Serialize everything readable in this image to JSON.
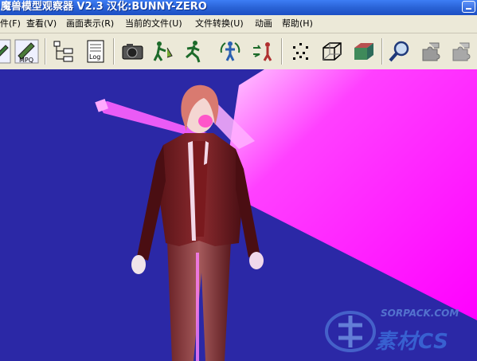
{
  "window": {
    "title": "魔兽模型观察器 V2.3 汉化:BUNNY-ZERO"
  },
  "menu": [
    {
      "label": "件(F)"
    },
    {
      "label": "查看(V)"
    },
    {
      "label": "画面表示(R)"
    },
    {
      "label": "当前的文件(U)"
    },
    {
      "label": "文件转换(U)"
    },
    {
      "label": "动画"
    },
    {
      "label": "帮助(H)"
    }
  ],
  "toolbar": {
    "icons": [
      "pen-icon",
      "mpq-icon",
      "tree-icon",
      "log-icon",
      "camera-icon",
      "model-pose-icon",
      "run-figure-icon",
      "rotate-figure-icon",
      "swap-figure-icon",
      "particles-icon",
      "wireframe-box-icon",
      "solid-box-icon",
      "magnify-icon",
      "puzzle-icon",
      "puzzle-disabled-icon"
    ],
    "mpq_label": "MPQ",
    "log_label": "Log"
  },
  "watermark": {
    "url": "SORPACK.COM",
    "brand": "素材CS"
  },
  "colors": {
    "viewport_bg": "#2b28a6",
    "particle": "#ff00ff",
    "titlebar": "#2a63d6"
  }
}
